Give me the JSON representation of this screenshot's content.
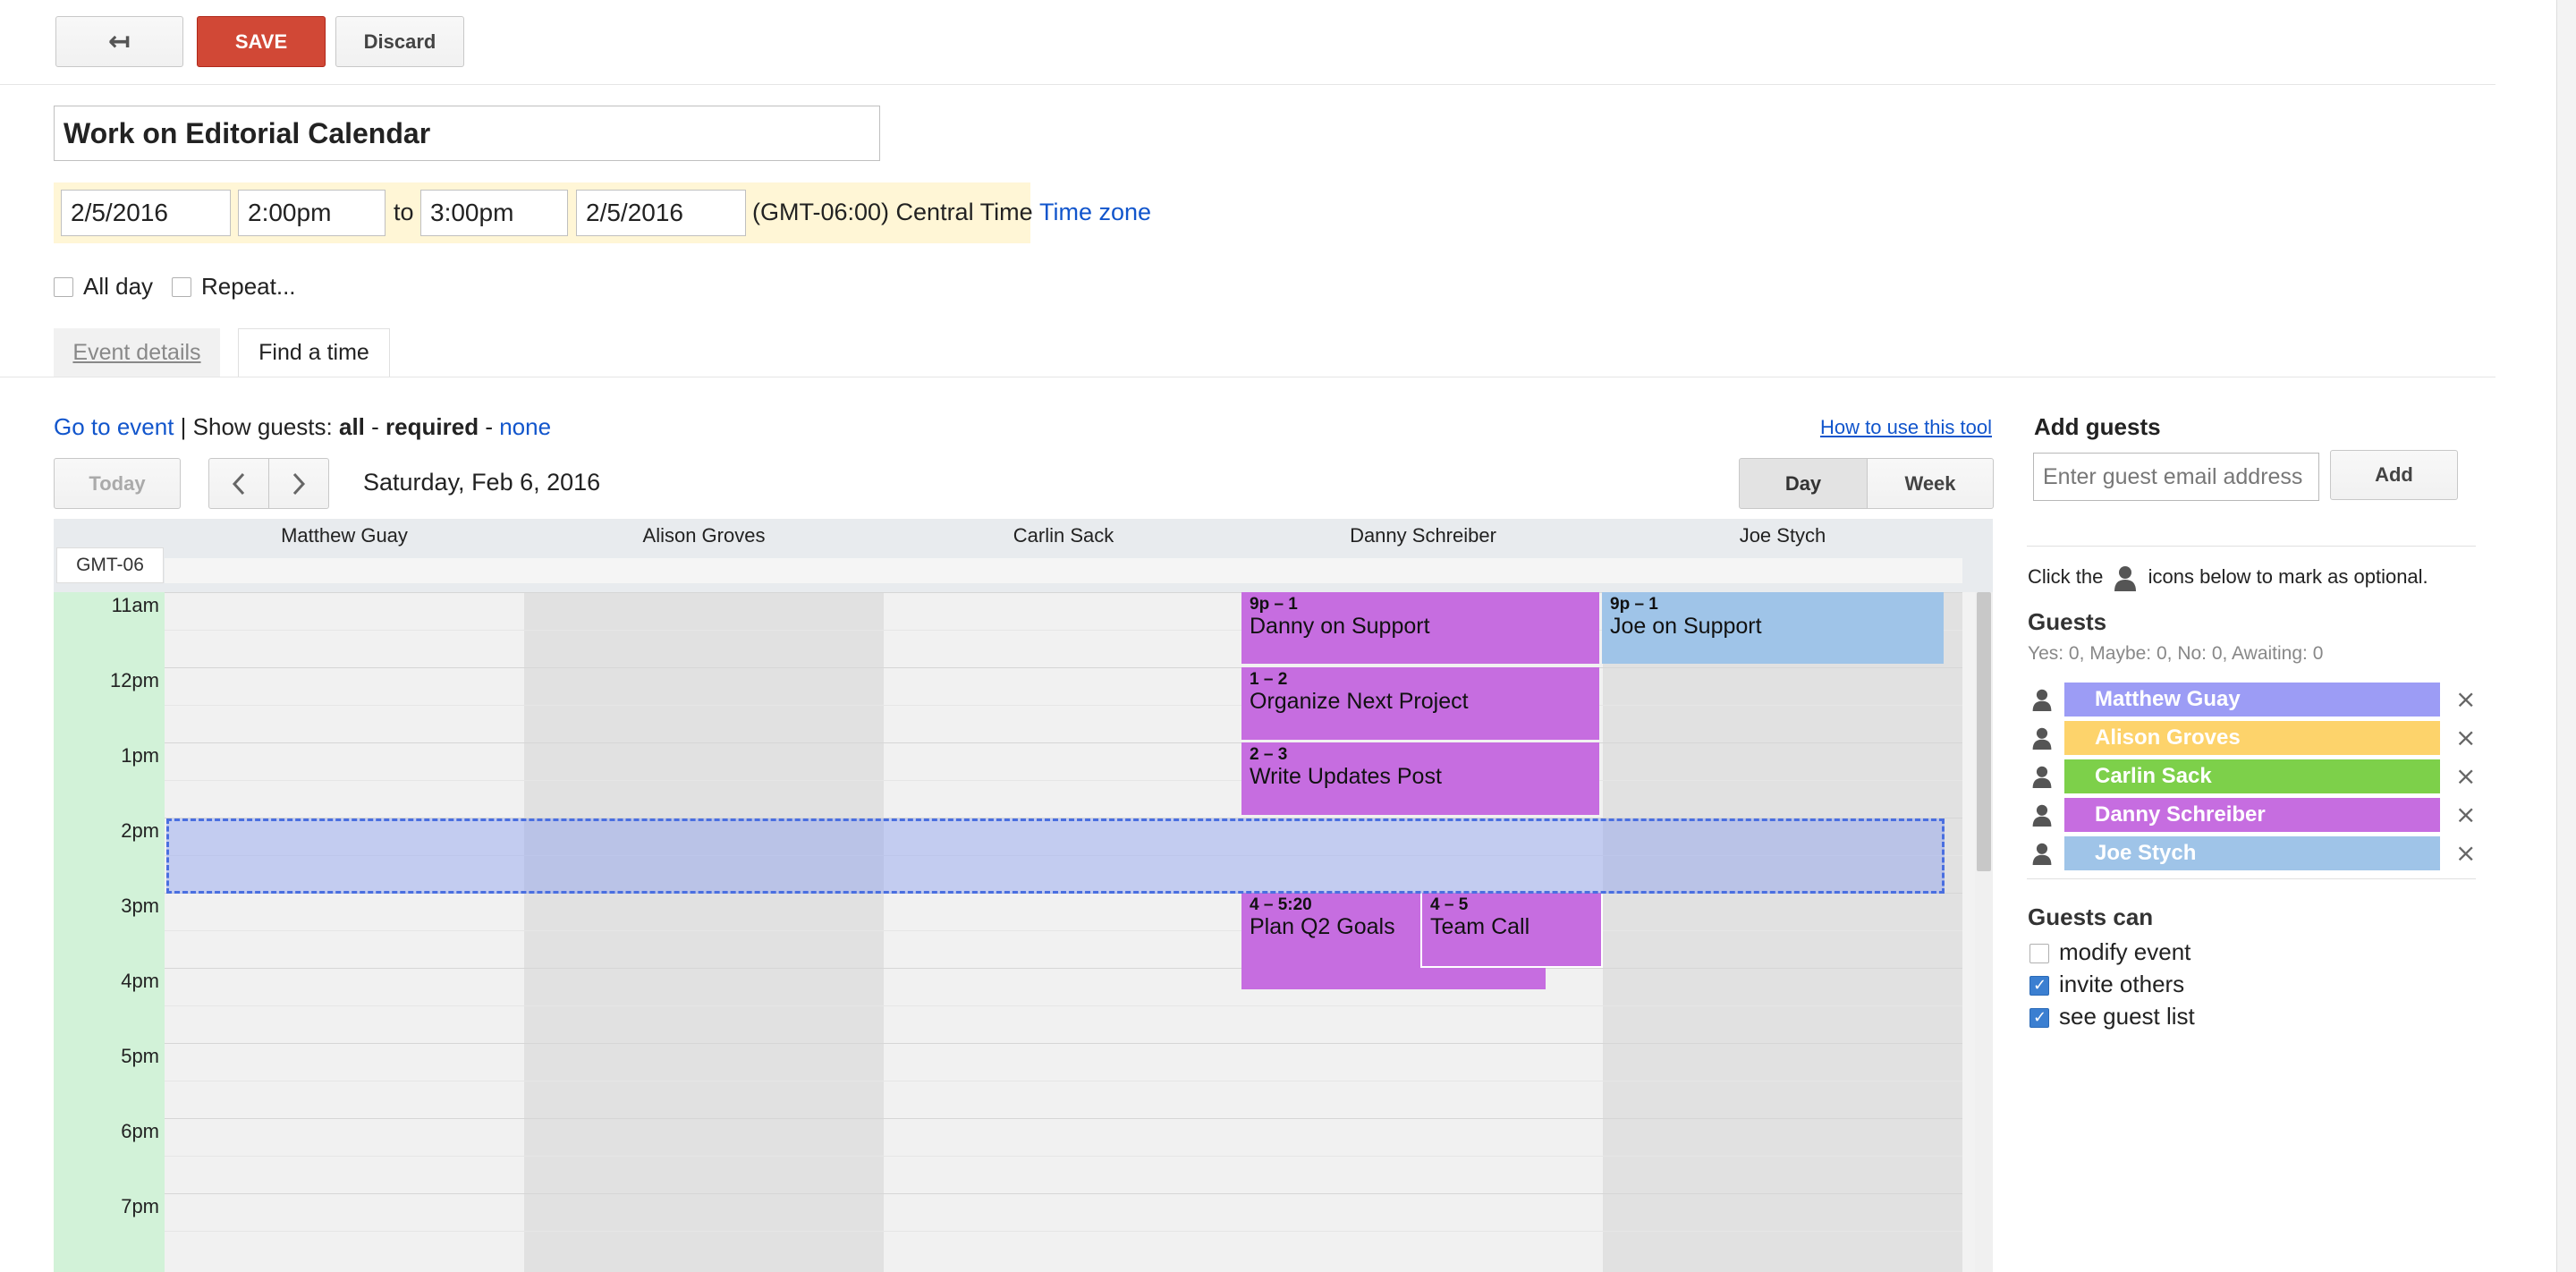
{
  "toolbar": {
    "back_label": "↤",
    "save_label": "SAVE",
    "discard_label": "Discard"
  },
  "event": {
    "title": "Work on Editorial Calendar",
    "start_date": "2/5/2016",
    "start_time": "2:00pm",
    "to_label": "to",
    "end_time": "3:00pm",
    "end_date": "2/5/2016",
    "timezone_text": "(GMT-06:00) Central Time",
    "timezone_link": "Time zone",
    "all_day_label": "All day",
    "repeat_label": "Repeat..."
  },
  "tabs": {
    "event_details": "Event details",
    "find_a_time": "Find a time"
  },
  "findtime": {
    "go_to_event": "Go to event",
    "separator": "|",
    "show_guests": "Show guests:",
    "all": "all",
    "dash1": "-",
    "required": "required",
    "dash2": "-",
    "none": "none",
    "how_to": "How to use this tool",
    "today": "Today",
    "prev_icon": "chevron-left",
    "next_icon": "chevron-right",
    "date_label": "Saturday, Feb 6, 2016",
    "day": "Day",
    "week": "Week",
    "timezone_label": "GMT-06",
    "columns": [
      "Matthew Guay",
      "Alison Groves",
      "Carlin Sack",
      "Danny Schreiber",
      "Joe Stych"
    ],
    "hours": [
      "11am",
      "12pm",
      "1pm",
      "2pm",
      "3pm",
      "4pm",
      "5pm",
      "6pm",
      "7pm"
    ],
    "events": [
      {
        "time": "9p – 1",
        "name": "Danny on Support",
        "color": "#c66de0"
      },
      {
        "time": "1 – 2",
        "name": "Organize Next Project",
        "color": "#c66de0"
      },
      {
        "time": "2 – 3",
        "name": "Write Updates Post",
        "color": "#c66de0"
      },
      {
        "time": "4 – 5:20",
        "name": "Plan Q2 Goals",
        "color": "#c66de0"
      },
      {
        "time": "4 – 5",
        "name": "Team Call",
        "color": "#c66de0"
      },
      {
        "time": "9p – 1",
        "name": "Joe on Support",
        "color": "#9fc4e8"
      }
    ]
  },
  "guests_panel": {
    "add_guests_title": "Add guests",
    "email_placeholder": "Enter guest email address",
    "add_button": "Add",
    "click_the": "Click the",
    "icons_below": "icons below to mark as optional.",
    "guests_title": "Guests",
    "guest_summary": "Yes: 0, Maybe: 0, No: 0, Awaiting: 0",
    "guests": [
      {
        "name": "Matthew Guay",
        "color": "#9c9cf5"
      },
      {
        "name": "Alison Groves",
        "color": "#fdd36b"
      },
      {
        "name": "Carlin Sack",
        "color": "#7dd04a"
      },
      {
        "name": "Danny Schreiber",
        "color": "#c66de0"
      },
      {
        "name": "Joe Stych",
        "color": "#9fc4e8"
      }
    ],
    "guests_can_title": "Guests can",
    "permissions": [
      {
        "label": "modify event",
        "checked": false
      },
      {
        "label": "invite others",
        "checked": true
      },
      {
        "label": "see guest list",
        "checked": true
      }
    ]
  }
}
